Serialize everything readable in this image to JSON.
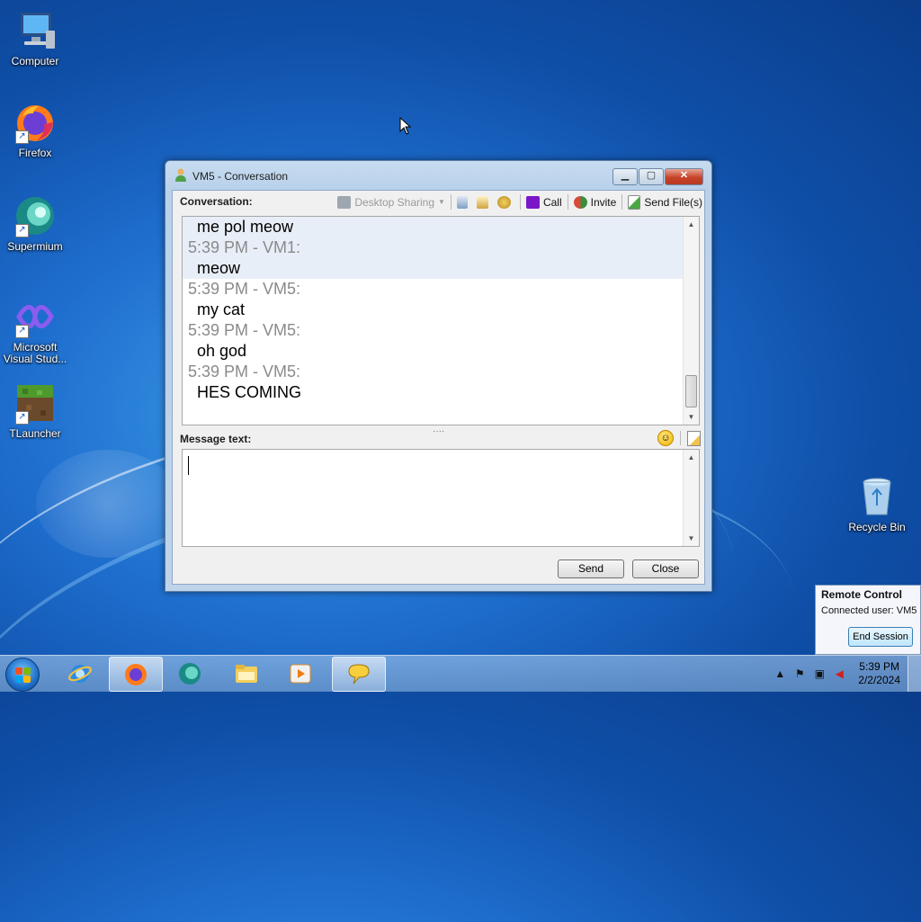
{
  "desktop": {
    "icons": [
      {
        "label": "Computer"
      },
      {
        "label": "Firefox"
      },
      {
        "label": "Supermium"
      },
      {
        "label": "Microsoft Visual Stud..."
      },
      {
        "label": "TLauncher"
      },
      {
        "label": "Recycle Bin"
      }
    ]
  },
  "window": {
    "title": "VM5 - Conversation",
    "conversation_label": "Conversation:",
    "toolbar": {
      "desktop_sharing": "Desktop Sharing",
      "call": "Call",
      "invite": "Invite",
      "send_files": "Send File(s)"
    },
    "messages": [
      {
        "text": "me pol meow"
      },
      {
        "meta": "5:39 PM - VM1:",
        "text": "meow"
      },
      {
        "meta": "5:39 PM - VM5:",
        "text": "my cat"
      },
      {
        "meta": "5:39 PM - VM5:",
        "text": "oh god"
      },
      {
        "meta": "5:39 PM - VM5:",
        "text": "HES COMING"
      }
    ],
    "grip": "····",
    "message_label": "Message text:",
    "send_label": "Send",
    "close_label": "Close"
  },
  "remote_control": {
    "title": "Remote Control",
    "connected": "Connected user:  VM5",
    "end_session": "End Session"
  },
  "taskbar": {
    "time": "5:39 PM",
    "date": "2/2/2024"
  }
}
